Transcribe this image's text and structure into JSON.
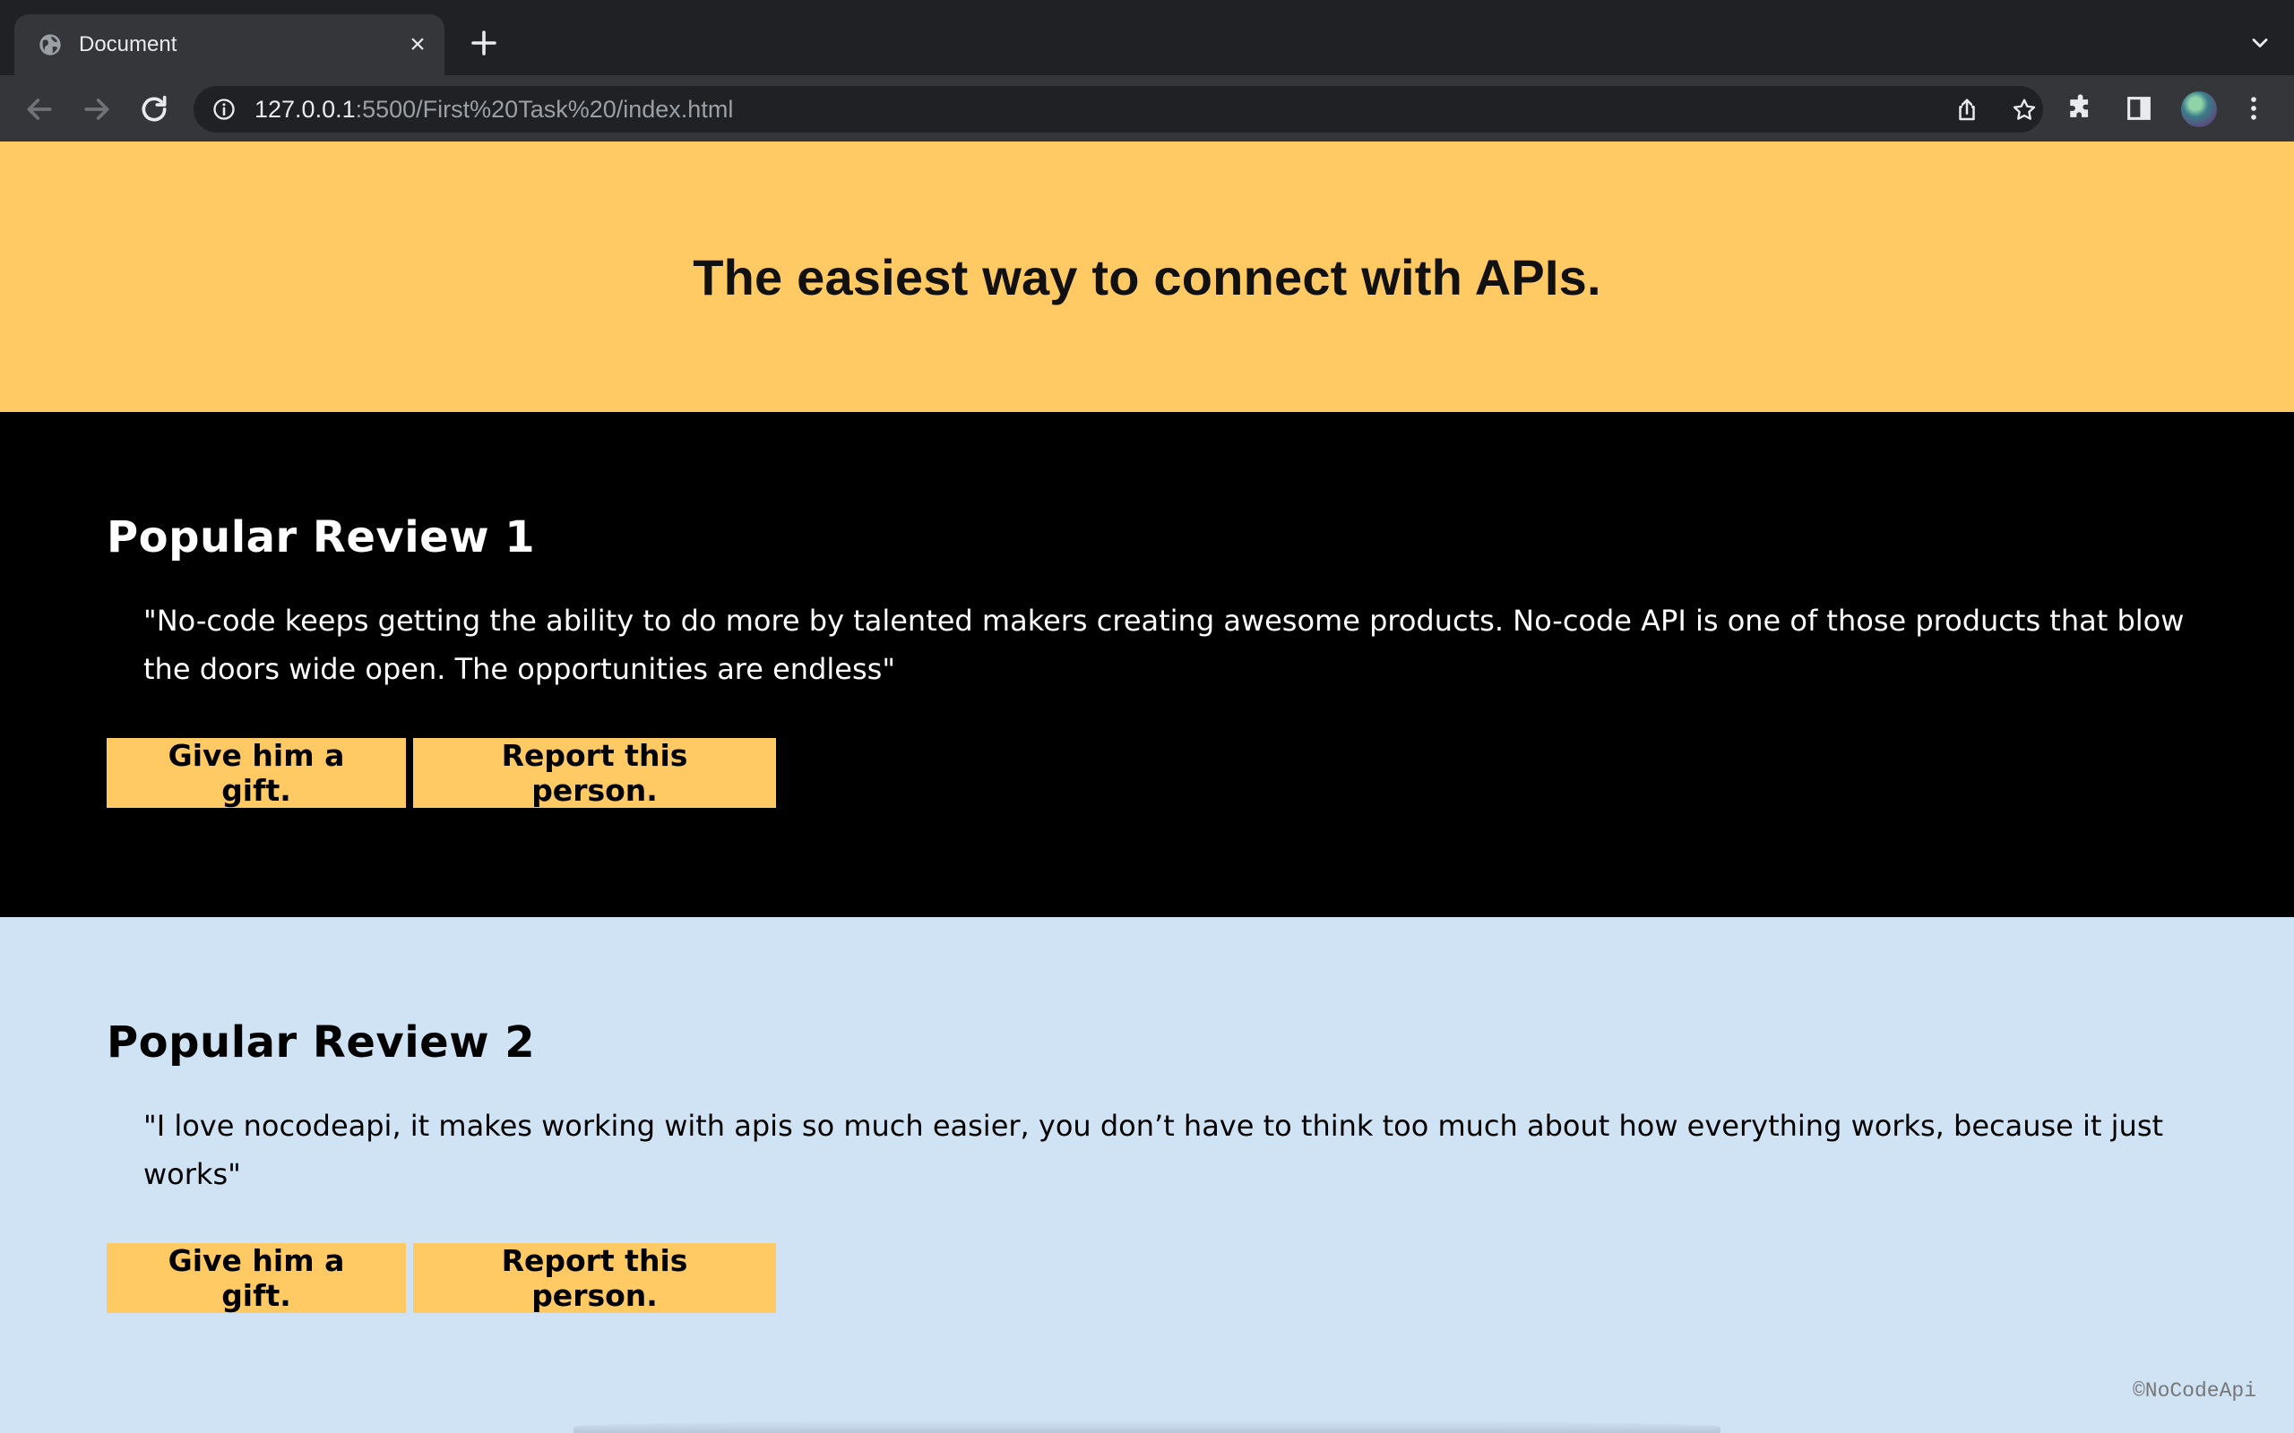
{
  "browser": {
    "tab_title": "Document",
    "tab_close": "×",
    "url_host": "127.0.0.1",
    "url_rest": ":5500/First%20Task%20/index.html"
  },
  "icons": {
    "favicon": "globe-icon",
    "new_tab": "plus-icon",
    "tab_search": "chevron-down-icon",
    "back": "arrow-left-icon",
    "forward": "arrow-right-icon",
    "reload": "reload-icon",
    "site_info": "info-icon",
    "share": "share-icon",
    "bookmark": "star-icon",
    "extensions": "puzzle-icon",
    "side_panel": "side-panel-icon",
    "menu": "kebab-menu-icon"
  },
  "hero": {
    "title": "The easiest way to connect with APIs."
  },
  "reviews": [
    {
      "title": "Popular Review 1",
      "quote": "\"No-code keeps getting the ability to do more by talented makers creating awesome products. No-code API is one of those products that blow the doors wide open. The opportunities are endless\"",
      "gift_label": "Give him a gift.",
      "report_label": "Report this person."
    },
    {
      "title": "Popular Review 2",
      "quote": "\"I love nocodeapi, it makes working with apis so much easier, you don’t have to think too much about how everything works, because it just works\"",
      "gift_label": "Give him a gift.",
      "report_label": "Report this person."
    }
  ],
  "footer": {
    "copyright": "©NoCodeApi"
  },
  "colors": {
    "accent_yellow": "#ffca64",
    "dark_section": "#000000",
    "light_section": "#cfe3f5",
    "chrome_dark": "#202124",
    "chrome_toolbar": "#35363a"
  }
}
